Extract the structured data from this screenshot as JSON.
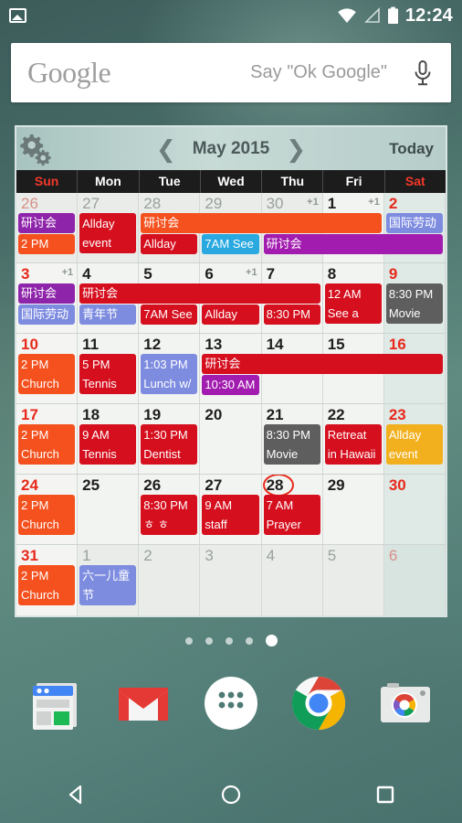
{
  "status_bar": {
    "left_icons": [
      {
        "name": "image-icon"
      }
    ],
    "right_icons": [
      {
        "name": "wifi-icon"
      },
      {
        "name": "cell-signal-icon"
      },
      {
        "name": "battery-icon"
      }
    ],
    "clock": "12:24"
  },
  "search": {
    "logo_text": "Google",
    "hint_text": "Say \"Ok Google\"",
    "mic_icon": "microphone-icon"
  },
  "calendar": {
    "settings_icon": "gear-icon",
    "prev_label": "❮",
    "next_label": "❯",
    "title": "May 2015",
    "today_label": "Today",
    "weekdays": [
      "Sun",
      "Mon",
      "Tue",
      "Wed",
      "Thu",
      "Fri",
      "Sat"
    ],
    "today_date": 28,
    "colors": {
      "red": "#d50f1e",
      "orange": "#f4511e",
      "purple": "#8e24aa",
      "violet": "#7b1fa2",
      "blue": "#2aa8e0",
      "lavender": "#7e8ce0",
      "gray": "#5e5e5e",
      "yellow": "#f2b01e",
      "weekend_text": "#e8291c",
      "header_bg": "#1c1c1c"
    },
    "weeks": [
      {
        "days": [
          {
            "num": "26",
            "dim": true,
            "weekend": true
          },
          {
            "num": "27",
            "dim": true
          },
          {
            "num": "28",
            "dim": true
          },
          {
            "num": "29",
            "dim": true
          },
          {
            "num": "30",
            "dim": true,
            "more": "+1"
          },
          {
            "num": "1",
            "more": "+1"
          },
          {
            "num": "2",
            "weekend": true
          }
        ],
        "events": [
          {
            "text": "研讨会",
            "col": 0,
            "span": 1,
            "row": 0,
            "color": "#8e24aa"
          },
          {
            "text": "2 PM",
            "col": 0,
            "span": 1,
            "row": 1,
            "color": "#f4511e"
          },
          {
            "text": "Allday event",
            "col": 1,
            "span": 1,
            "row": 0,
            "rows": 2,
            "color": "#d50f1e"
          },
          {
            "text": "研讨会",
            "col": 2,
            "span": 4,
            "row": 0,
            "color": "#f4511e"
          },
          {
            "text": "Allday",
            "col": 2,
            "span": 1,
            "row": 1,
            "color": "#d50f1e"
          },
          {
            "text": "7AM See",
            "col": 3,
            "span": 1,
            "row": 1,
            "color": "#2aa8e0"
          },
          {
            "text": "研讨会",
            "col": 4,
            "span": 3,
            "row": 1,
            "color": "#a21caf"
          },
          {
            "text": "国际劳动",
            "col": 6,
            "span": 1,
            "row": 0,
            "color": "#7e8ce0"
          }
        ]
      },
      {
        "days": [
          {
            "num": "3",
            "weekend": true,
            "more": "+1"
          },
          {
            "num": "4"
          },
          {
            "num": "5"
          },
          {
            "num": "6",
            "more": "+1"
          },
          {
            "num": "7"
          },
          {
            "num": "8"
          },
          {
            "num": "9",
            "weekend": true
          }
        ],
        "events": [
          {
            "text": "研讨会",
            "col": 0,
            "span": 1,
            "row": 0,
            "color": "#8e24aa"
          },
          {
            "text": "国际劳动",
            "col": 0,
            "span": 1,
            "row": 1,
            "color": "#7e8ce0"
          },
          {
            "text": "研讨会",
            "col": 1,
            "span": 4,
            "row": 0,
            "color": "#d50f1e"
          },
          {
            "text": "青年节",
            "col": 1,
            "span": 1,
            "row": 1,
            "color": "#7e8ce0"
          },
          {
            "text": "7AM See",
            "col": 2,
            "span": 1,
            "row": 1,
            "color": "#d50f1e"
          },
          {
            "text": "Allday",
            "col": 3,
            "span": 1,
            "row": 1,
            "color": "#d50f1e"
          },
          {
            "text": "8:30 PM",
            "col": 4,
            "span": 1,
            "row": 1,
            "color": "#d50f1e"
          },
          {
            "text": "12 AM See a",
            "col": 5,
            "span": 1,
            "row": 0,
            "rows": 2,
            "color": "#d50f1e"
          },
          {
            "text": "8:30 PM Movie",
            "col": 6,
            "span": 1,
            "row": 0,
            "rows": 2,
            "color": "#5e5e5e"
          }
        ]
      },
      {
        "days": [
          {
            "num": "10",
            "weekend": true
          },
          {
            "num": "11"
          },
          {
            "num": "12"
          },
          {
            "num": "13"
          },
          {
            "num": "14"
          },
          {
            "num": "15"
          },
          {
            "num": "16",
            "weekend": true
          }
        ],
        "events": [
          {
            "text": "2 PM Church",
            "col": 0,
            "span": 1,
            "row": 0,
            "rows": 2,
            "color": "#f4511e"
          },
          {
            "text": "5 PM Tennis",
            "col": 1,
            "span": 1,
            "row": 0,
            "rows": 2,
            "color": "#d50f1e"
          },
          {
            "text": "1:03 PM Lunch w/",
            "col": 2,
            "span": 1,
            "row": 0,
            "rows": 2,
            "color": "#7e8ce0"
          },
          {
            "text": "研讨会",
            "col": 3,
            "span": 4,
            "row": 0,
            "color": "#d50f1e"
          },
          {
            "text": "10:30 AM",
            "col": 3,
            "span": 1,
            "row": 1,
            "color": "#a21caf"
          }
        ]
      },
      {
        "days": [
          {
            "num": "17",
            "weekend": true
          },
          {
            "num": "18"
          },
          {
            "num": "19"
          },
          {
            "num": "20"
          },
          {
            "num": "21"
          },
          {
            "num": "22"
          },
          {
            "num": "23",
            "weekend": true
          }
        ],
        "events": [
          {
            "text": "2 PM Church",
            "col": 0,
            "span": 1,
            "row": 0,
            "rows": 2,
            "color": "#f4511e"
          },
          {
            "text": "9 AM Tennis",
            "col": 1,
            "span": 1,
            "row": 0,
            "rows": 2,
            "color": "#d50f1e"
          },
          {
            "text": "1:30 PM Dentist",
            "col": 2,
            "span": 1,
            "row": 0,
            "rows": 2,
            "color": "#d50f1e"
          },
          {
            "text": "8:30 PM Movie",
            "col": 4,
            "span": 1,
            "row": 0,
            "rows": 2,
            "color": "#5e5e5e"
          },
          {
            "text": "Retreat in Hawaii",
            "col": 5,
            "span": 1,
            "row": 0,
            "rows": 2,
            "color": "#d50f1e"
          },
          {
            "text": "Allday event",
            "col": 6,
            "span": 1,
            "row": 0,
            "rows": 2,
            "color": "#f2b01e"
          }
        ]
      },
      {
        "days": [
          {
            "num": "24",
            "weekend": true
          },
          {
            "num": "25"
          },
          {
            "num": "26"
          },
          {
            "num": "27"
          },
          {
            "num": "28",
            "today": true
          },
          {
            "num": "29"
          },
          {
            "num": "30",
            "weekend": true
          }
        ],
        "events": [
          {
            "text": "2 PM Church",
            "col": 0,
            "span": 1,
            "row": 0,
            "rows": 2,
            "color": "#f4511e"
          },
          {
            "text": "8:30 PM ㅎ ㅎ",
            "col": 2,
            "span": 1,
            "row": 0,
            "rows": 2,
            "color": "#d50f1e"
          },
          {
            "text": "9 AM staff",
            "col": 3,
            "span": 1,
            "row": 0,
            "rows": 2,
            "color": "#d50f1e"
          },
          {
            "text": "7 AM Prayer",
            "col": 4,
            "span": 1,
            "row": 0,
            "rows": 2,
            "color": "#d50f1e"
          }
        ]
      },
      {
        "days": [
          {
            "num": "31",
            "weekend": true
          },
          {
            "num": "1",
            "dim": true
          },
          {
            "num": "2",
            "dim": true
          },
          {
            "num": "3",
            "dim": true
          },
          {
            "num": "4",
            "dim": true
          },
          {
            "num": "5",
            "dim": true
          },
          {
            "num": "6",
            "dim": true,
            "weekend": true
          }
        ],
        "events": [
          {
            "text": "2 PM Church",
            "col": 0,
            "span": 1,
            "row": 0,
            "rows": 2,
            "color": "#f4511e"
          },
          {
            "text": "六一儿童节",
            "col": 1,
            "span": 1,
            "row": 0,
            "rows": 2,
            "color": "#7e8ce0"
          }
        ]
      }
    ]
  },
  "page_dots": {
    "count": 5,
    "active_index": 4
  },
  "dock": {
    "apps": [
      {
        "name": "news-app-icon",
        "label": "News"
      },
      {
        "name": "gmail-app-icon",
        "label": "Gmail"
      },
      {
        "name": "app-drawer-icon",
        "label": "Apps"
      },
      {
        "name": "chrome-app-icon",
        "label": "Chrome"
      },
      {
        "name": "camera-app-icon",
        "label": "Camera"
      }
    ]
  },
  "nav_bar": {
    "buttons": [
      {
        "name": "back-button",
        "label": "Back"
      },
      {
        "name": "home-button",
        "label": "Home"
      },
      {
        "name": "recents-button",
        "label": "Recents"
      }
    ]
  }
}
